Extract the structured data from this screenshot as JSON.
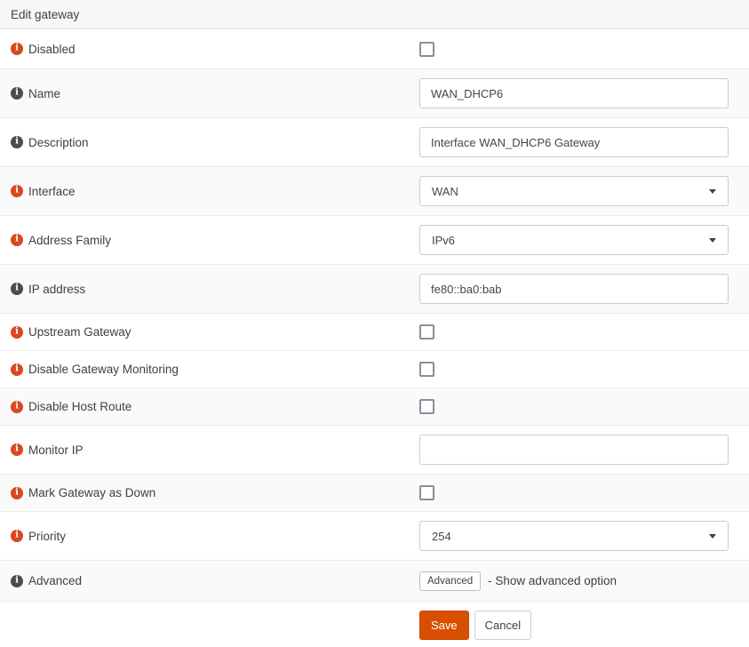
{
  "header": {
    "title": "Edit gateway"
  },
  "rows": [
    {
      "id": "disabled",
      "label": "Disabled",
      "icon": "orange",
      "control": "checkbox",
      "checked": false,
      "striped": false
    },
    {
      "id": "name",
      "label": "Name",
      "icon": "gray",
      "control": "text",
      "value": "WAN_DHCP6",
      "striped": true
    },
    {
      "id": "description",
      "label": "Description",
      "icon": "gray",
      "control": "text",
      "value": "Interface WAN_DHCP6 Gateway",
      "striped": false
    },
    {
      "id": "interface",
      "label": "Interface",
      "icon": "orange",
      "control": "select",
      "value": "WAN",
      "striped": true
    },
    {
      "id": "address-family",
      "label": "Address Family",
      "icon": "orange",
      "control": "select",
      "value": "IPv6",
      "striped": false
    },
    {
      "id": "ip-address",
      "label": "IP address",
      "icon": "gray",
      "control": "text",
      "value": "fe80::ba0:bab",
      "striped": true
    },
    {
      "id": "upstream-gateway",
      "label": "Upstream Gateway",
      "icon": "orange",
      "control": "checkbox",
      "checked": false,
      "striped": false
    },
    {
      "id": "disable-gateway-monitoring",
      "label": "Disable Gateway Monitoring",
      "icon": "orange",
      "control": "checkbox",
      "checked": false,
      "striped": false
    },
    {
      "id": "disable-host-route",
      "label": "Disable Host Route",
      "icon": "orange",
      "control": "checkbox",
      "checked": false,
      "striped": true
    },
    {
      "id": "monitor-ip",
      "label": "Monitor IP",
      "icon": "orange",
      "control": "text",
      "value": "",
      "striped": false
    },
    {
      "id": "mark-gateway-as-down",
      "label": "Mark Gateway as Down",
      "icon": "orange",
      "control": "checkbox",
      "checked": false,
      "striped": true
    },
    {
      "id": "priority",
      "label": "Priority",
      "icon": "orange",
      "control": "select",
      "value": "254",
      "striped": false
    },
    {
      "id": "advanced",
      "label": "Advanced",
      "icon": "gray",
      "control": "advanced",
      "button_label": "Advanced",
      "note": "- Show advanced option",
      "striped": true
    }
  ],
  "buttons": {
    "save": "Save",
    "cancel": "Cancel"
  },
  "colors": {
    "save_button": "#d94f00",
    "info_icon_highlight": "#d9481f",
    "info_icon_default": "#4c4c4c",
    "row_stripe": "#fafafa",
    "row_border": "#ebebeb",
    "header_background": "#f7f7f7"
  }
}
